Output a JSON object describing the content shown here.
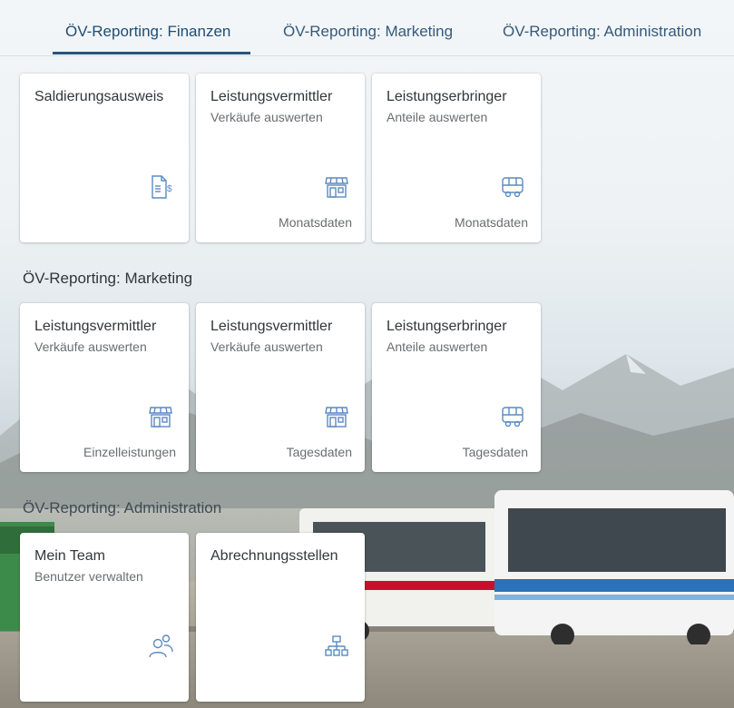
{
  "tabs": [
    {
      "label": "ÖV-Reporting: Finanzen"
    },
    {
      "label": "ÖV-Reporting: Marketing"
    },
    {
      "label": "ÖV-Reporting: Administration"
    }
  ],
  "sections": {
    "marketing": {
      "title": "ÖV-Reporting: Marketing"
    },
    "administration": {
      "title": "ÖV-Reporting: Administration"
    }
  },
  "finanzen_tiles": [
    {
      "title": "Saldierungsausweis",
      "subtitle": "",
      "footer": "",
      "icon": "invoice-dollar-icon"
    },
    {
      "title": "Leistungsvermittler",
      "subtitle": "Verkäufe auswerten",
      "footer": "Monatsdaten",
      "icon": "shop-icon"
    },
    {
      "title": "Leistungserbringer",
      "subtitle": "Anteile auswerten",
      "footer": "Monatsdaten",
      "icon": "bus-icon"
    }
  ],
  "marketing_tiles": [
    {
      "title": "Leistungsvermittler",
      "subtitle": "Verkäufe auswerten",
      "footer": "Einzelleistungen",
      "icon": "shop-icon"
    },
    {
      "title": "Leistungsvermittler",
      "subtitle": "Verkäufe auswerten",
      "footer": "Tagesdaten",
      "icon": "shop-icon"
    },
    {
      "title": "Leistungserbringer",
      "subtitle": "Anteile auswerten",
      "footer": "Tagesdaten",
      "icon": "bus-icon"
    }
  ],
  "administration_tiles": [
    {
      "title": "Mein Team",
      "subtitle": "Benutzer verwalten",
      "footer": "",
      "icon": "group-icon"
    },
    {
      "title": "Abrechnungsstellen",
      "subtitle": "",
      "footer": "",
      "icon": "org-chart-icon"
    }
  ],
  "colors": {
    "tab_text": "#355a7a",
    "tab_underline": "#27557b",
    "icon": "#5b8ac1",
    "tile_bg": "#ffffff"
  }
}
